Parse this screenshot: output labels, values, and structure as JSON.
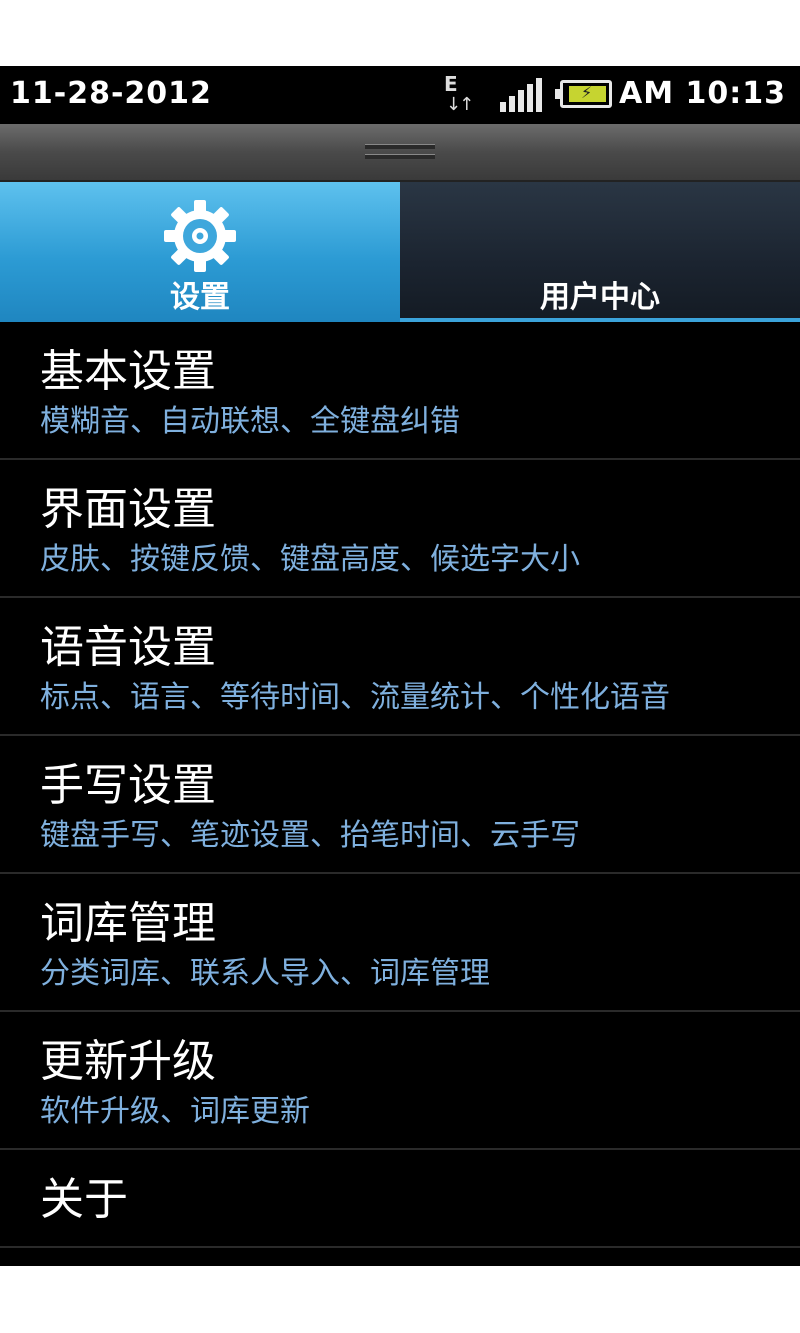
{
  "statusbar": {
    "date": "11-28-2012",
    "network": "E",
    "time": "AM 10:13",
    "battery_color": "#c6d430"
  },
  "tabs": [
    {
      "label": "设置",
      "icon": "gear-icon",
      "active": true
    },
    {
      "label": "用户中心",
      "icon": "user-icon",
      "active": false
    }
  ],
  "settings": [
    {
      "title": "基本设置",
      "subtitle": "模糊音、自动联想、全键盘纠错"
    },
    {
      "title": "界面设置",
      "subtitle": "皮肤、按键反馈、键盘高度、候选字大小"
    },
    {
      "title": "语音设置",
      "subtitle": "标点、语言、等待时间、流量统计、个性化语音"
    },
    {
      "title": "手写设置",
      "subtitle": "键盘手写、笔迹设置、抬笔时间、云手写"
    },
    {
      "title": "词库管理",
      "subtitle": "分类词库、联系人导入、词库管理"
    },
    {
      "title": "更新升级",
      "subtitle": "软件升级、词库更新"
    },
    {
      "title": "关于",
      "subtitle": ""
    }
  ],
  "colors": {
    "accent": "#2c9bd4",
    "subtitle": "#7fb0de"
  }
}
